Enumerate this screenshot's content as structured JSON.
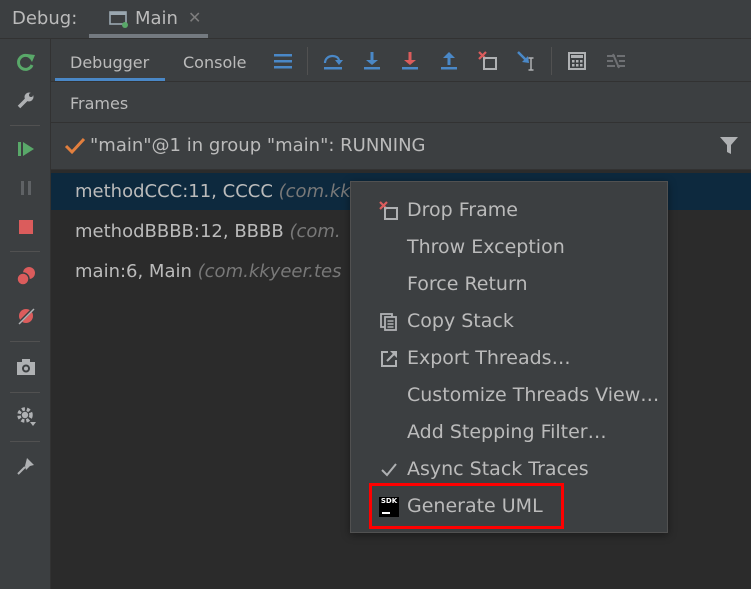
{
  "tabbar": {
    "debug_label": "Debug:",
    "tab_label": "Main",
    "close_glyph": "✕"
  },
  "toolbar": {
    "tabs": [
      "Debugger",
      "Console"
    ]
  },
  "frames": {
    "title": "Frames",
    "thread": "\"main\"@1 in group \"main\": RUNNING",
    "items": [
      {
        "method": "methodCCC:11, CCCC",
        "pkg": "(com.kk"
      },
      {
        "method": "methodBBBB:12, BBBB",
        "pkg": "(com."
      },
      {
        "method": "main:6, Main",
        "pkg": "(com.kkyeer.tes"
      }
    ]
  },
  "context_menu": {
    "items": [
      {
        "label": "Drop Frame",
        "icon": "drop-frame-icon"
      },
      {
        "label": "Throw Exception",
        "icon": ""
      },
      {
        "label": "Force Return",
        "icon": ""
      },
      {
        "label": "Copy Stack",
        "icon": "copy-stack-icon"
      },
      {
        "label": "Export Threads…",
        "icon": "export-icon"
      },
      {
        "label": "Customize Threads View…",
        "icon": ""
      },
      {
        "label": "Add Stepping Filter…",
        "icon": ""
      },
      {
        "label": "Async Stack Traces",
        "icon": "checkmark-icon"
      },
      {
        "label": "Generate UML",
        "icon": "sdk-icon"
      }
    ],
    "sdk_icon_text": "SDK"
  },
  "colors": {
    "background": "#3c3f41",
    "list_background": "#2b2b2b",
    "selection": "#0d293e",
    "accent_blue": "#4a88c7",
    "resume_green": "#59a869",
    "stop_red": "#db5c5c",
    "highlight_red": "#ff0000"
  }
}
